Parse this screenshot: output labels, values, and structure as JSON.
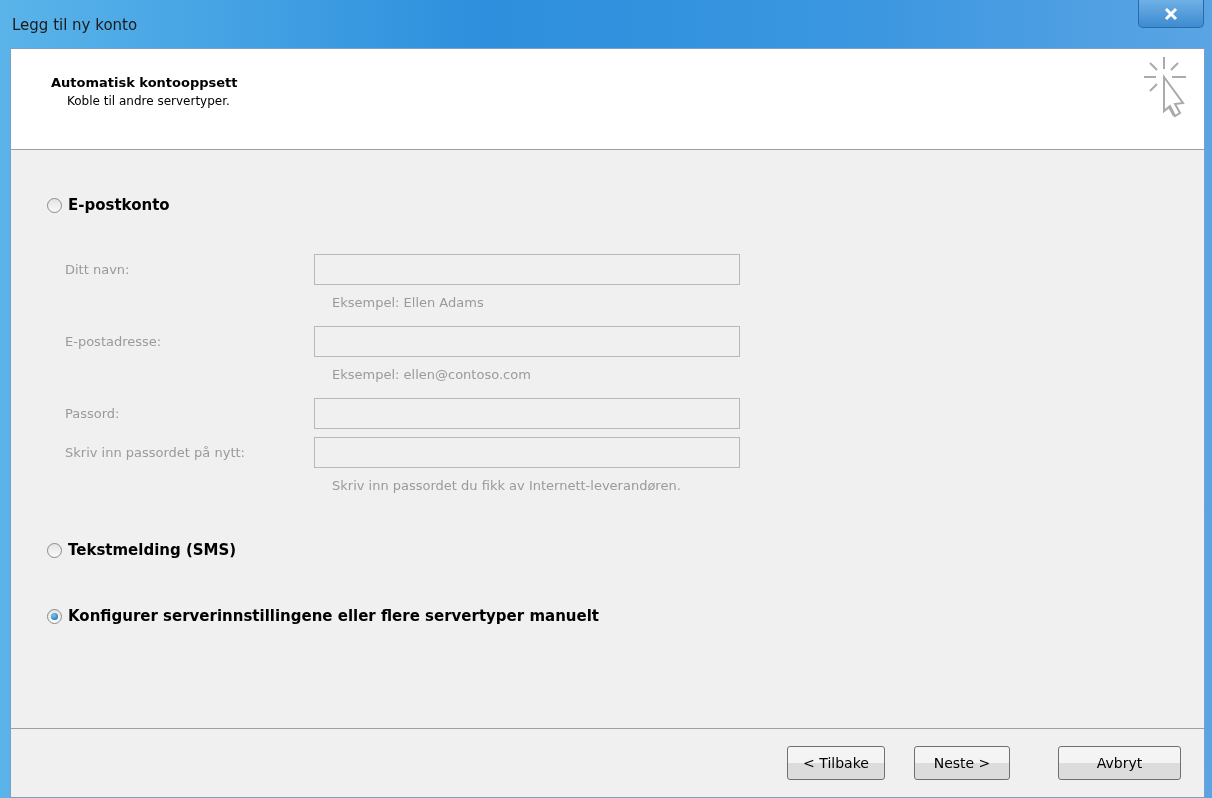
{
  "window": {
    "title": "Legg til ny konto"
  },
  "header": {
    "title": "Automatisk kontooppsett",
    "subtitle": "Koble til andre servertyper."
  },
  "options": [
    {
      "label": "E-postkonto",
      "selected": false,
      "fields": [
        {
          "label": "Ditt navn:",
          "disabled": true,
          "hint": "Eksempel: Ellen Adams"
        },
        {
          "label": "E-postadresse:",
          "disabled": true,
          "hint": "Eksempel: ellen@contoso.com"
        },
        {
          "label": "Passord:",
          "disabled": true
        },
        {
          "label": "Skriv inn passordet på nytt:",
          "disabled": true,
          "hint": "Skriv inn passordet du fikk av Internett-leverandøren."
        }
      ]
    },
    {
      "label": "Tekstmelding (SMS)",
      "selected": false
    },
    {
      "label": "Konfigurer serverinnstillingene eller flere servertyper manuelt",
      "selected": true
    }
  ],
  "buttons": [
    "< Tilbake",
    "Neste >",
    "Avbryt"
  ]
}
